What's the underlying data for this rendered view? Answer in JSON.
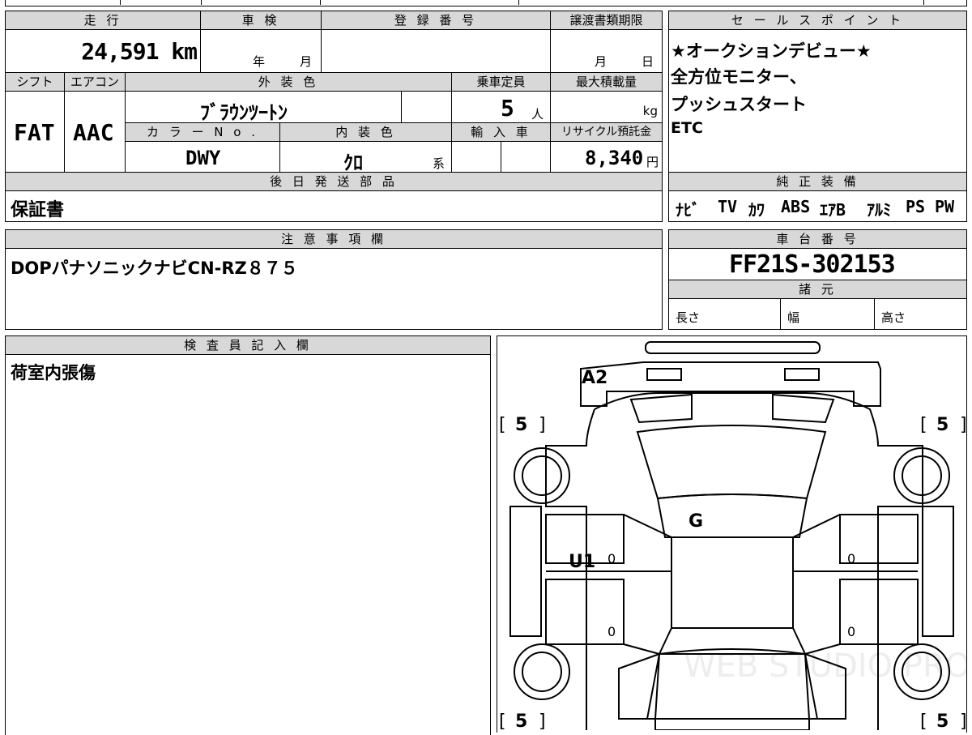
{
  "top_left": {
    "mileage_label": "走 行",
    "mileage_value": "24,591 km",
    "inspection_label": "車 検",
    "inspection_year_unit": "年",
    "inspection_month_unit": "月",
    "registration_label": "登 録 番 号",
    "transfer_label": "譲渡書類期限",
    "transfer_month_unit": "月",
    "transfer_day_unit": "日",
    "shift_label": "シフト",
    "shift_value": "FAT",
    "aircon_label": "エアコン",
    "aircon_value": "AAC",
    "exterior_color_label": "外 装 色",
    "exterior_color_value": "ﾌﾞﾗｳﾝﾂｰﾄﾝ",
    "capacity_label": "乗車定員",
    "capacity_value": "5",
    "capacity_unit": "人",
    "max_load_label": "最大積載量",
    "max_load_unit": "kg",
    "color_no_label": "カ ラ ー N o .",
    "color_no_value": "DWY",
    "interior_color_label": "内 装 色",
    "interior_color_value": "ｸﾛ",
    "interior_color_suffix": "系",
    "import_label": "輸 入 車",
    "recycle_label": "リサイクル預託金",
    "recycle_value": "8,340",
    "recycle_unit": "円",
    "shipping_label": "後 日 発 送 部 品",
    "shipping_value": "保証書"
  },
  "sales_points": {
    "label": "セ ー ル ス ポ イ ン ト",
    "lines": [
      "★オークションデビュー★",
      "全方位モニター、",
      "プッシュスタート",
      "ETC"
    ]
  },
  "genuine_equipment": {
    "label": "純 正 装 備",
    "items": [
      "ﾅﾋﾞ",
      "TV",
      "ｶﾜ",
      "ABS",
      "ｴｱB",
      "ｱﾙﾐ",
      "PS",
      "PW"
    ]
  },
  "notes": {
    "label": "注 意 事 項 欄",
    "value": "DOPパナソニックナビCN-RZ８７５"
  },
  "chassis": {
    "label": "車 台 番 号",
    "value": "FF21S-302153",
    "specs_label": "諸 元",
    "length_label": "長さ",
    "width_label": "幅",
    "height_label": "高さ"
  },
  "inspector": {
    "label": "検 査 員 記 入 欄",
    "value": "荷室内張傷"
  },
  "diagram": {
    "marks": {
      "rear": "A2",
      "roof": "G",
      "left_door": "U1"
    },
    "tire_depths": [
      "5",
      "5",
      "5",
      "5"
    ],
    "door_zeros": [
      "0",
      "0",
      "0",
      "0"
    ],
    "watermark": "WEB STUDIO PRO"
  }
}
